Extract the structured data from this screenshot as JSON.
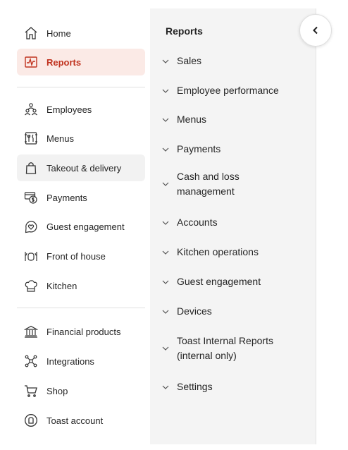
{
  "nav": {
    "items": [
      {
        "label": "Home",
        "icon": "home-icon"
      },
      {
        "label": "Reports",
        "icon": "reports-chart-icon"
      },
      {
        "label": "Employees",
        "icon": "employees-icon"
      },
      {
        "label": "Menus",
        "icon": "menus-icon"
      },
      {
        "label": "Takeout & delivery",
        "icon": "takeout-bag-icon"
      },
      {
        "label": "Payments",
        "icon": "payments-icon"
      },
      {
        "label": "Guest engagement",
        "icon": "guest-engagement-icon"
      },
      {
        "label": "Front of house",
        "icon": "front-of-house-icon"
      },
      {
        "label": "Kitchen",
        "icon": "kitchen-icon"
      },
      {
        "label": "Financial products",
        "icon": "bank-icon"
      },
      {
        "label": "Integrations",
        "icon": "integrations-icon"
      },
      {
        "label": "Shop",
        "icon": "cart-icon"
      },
      {
        "label": "Toast account",
        "icon": "toast-account-icon"
      }
    ],
    "active_index": 1,
    "active_color": "#c0321e",
    "active_bg": "#fbeae6"
  },
  "reports_panel": {
    "title": "Reports",
    "items": [
      {
        "label": "Sales"
      },
      {
        "label": "Employee performance"
      },
      {
        "label": "Menus"
      },
      {
        "label": "Payments"
      },
      {
        "label": "Cash and loss\nmanagement"
      },
      {
        "label": "Accounts"
      },
      {
        "label": "Kitchen operations"
      },
      {
        "label": "Guest engagement"
      },
      {
        "label": "Devices"
      },
      {
        "label": "Toast Internal Reports\n(internal only)"
      },
      {
        "label": "Settings"
      }
    ]
  },
  "collapse_button": {
    "icon": "chevron-left-icon"
  }
}
